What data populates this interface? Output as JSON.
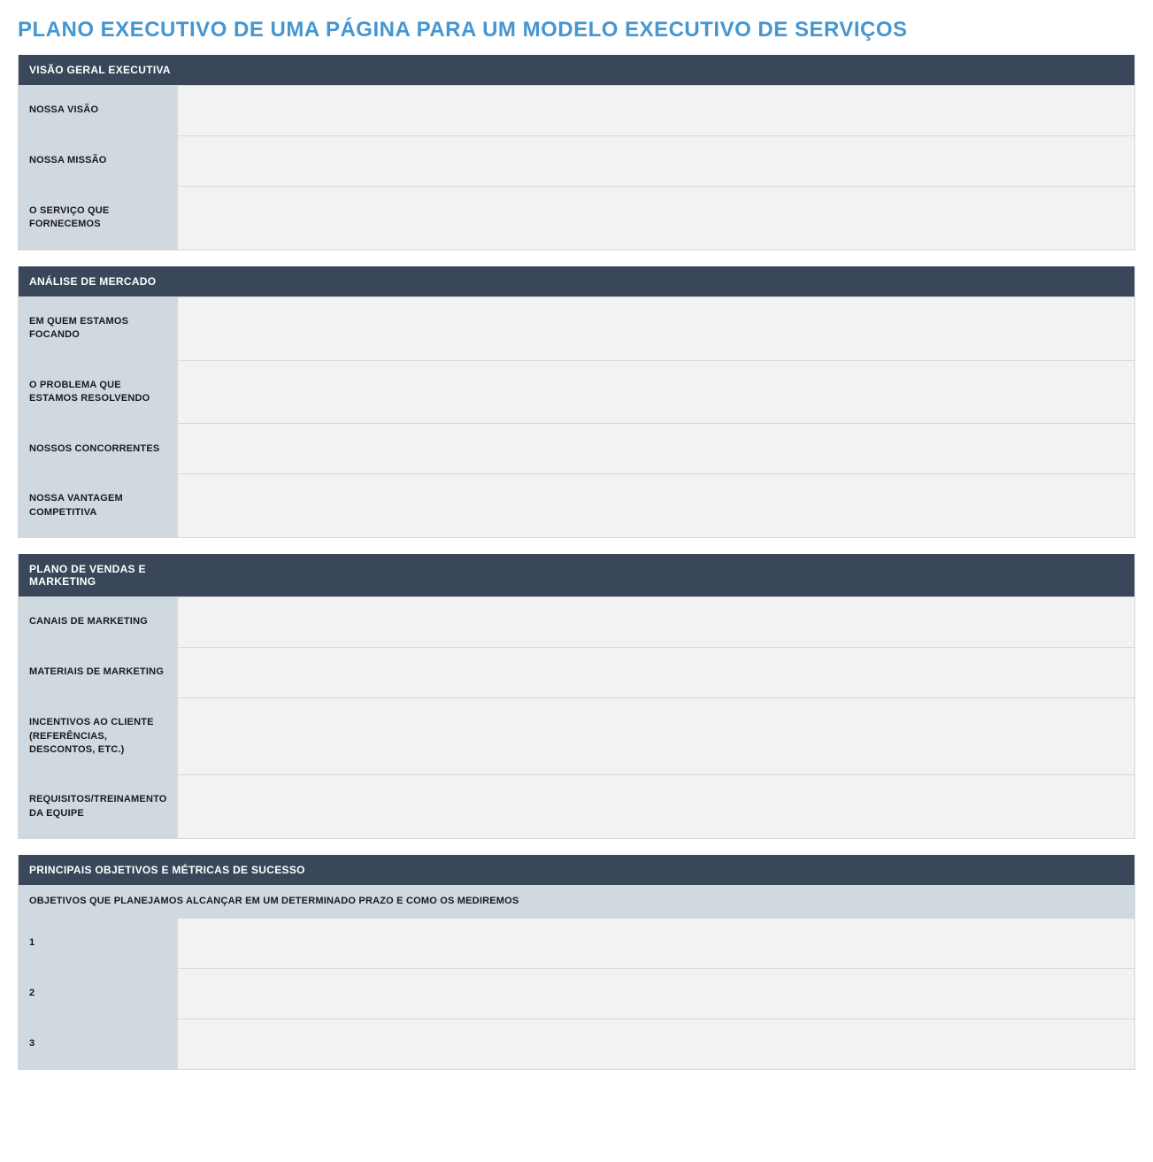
{
  "title": "PLANO EXECUTIVO DE UMA PÁGINA PARA UM MODELO EXECUTIVO DE SERVIÇOS",
  "sections": [
    {
      "header": "VISÃO GERAL EXECUTIVA",
      "rows": [
        {
          "label": "NOSSA VISÃO",
          "value": ""
        },
        {
          "label": "NOSSA MISSÃO",
          "value": ""
        },
        {
          "label": "O SERVIÇO QUE FORNECEMOS",
          "value": ""
        }
      ]
    },
    {
      "header": "ANÁLISE DE MERCADO",
      "rows": [
        {
          "label": "EM QUEM ESTAMOS FOCANDO",
          "value": ""
        },
        {
          "label": "O PROBLEMA QUE ESTAMOS RESOLVENDO",
          "value": ""
        },
        {
          "label": "NOSSOS CONCORRENTES",
          "value": ""
        },
        {
          "label": "NOSSA VANTAGEM COMPETITIVA",
          "value": ""
        }
      ]
    },
    {
      "header": "PLANO DE VENDAS E MARKETING",
      "rows": [
        {
          "label": "CANAIS DE MARKETING",
          "value": ""
        },
        {
          "label": "MATERIAIS DE MARKETING",
          "value": ""
        },
        {
          "label": "INCENTIVOS AO CLIENTE (REFERÊNCIAS, DESCONTOS, ETC.)",
          "value": ""
        },
        {
          "label": "REQUISITOS/TREINAMENTO DA EQUIPE",
          "value": ""
        }
      ]
    },
    {
      "header": "PRINCIPAIS OBJETIVOS E MÉTRICAS DE SUCESSO",
      "subheader": "OBJETIVOS QUE PLANEJAMOS ALCANÇAR EM UM DETERMINADO PRAZO E COMO OS MEDIREMOS",
      "rows": [
        {
          "label": "1",
          "value": ""
        },
        {
          "label": "2",
          "value": ""
        },
        {
          "label": "3",
          "value": ""
        }
      ]
    }
  ]
}
